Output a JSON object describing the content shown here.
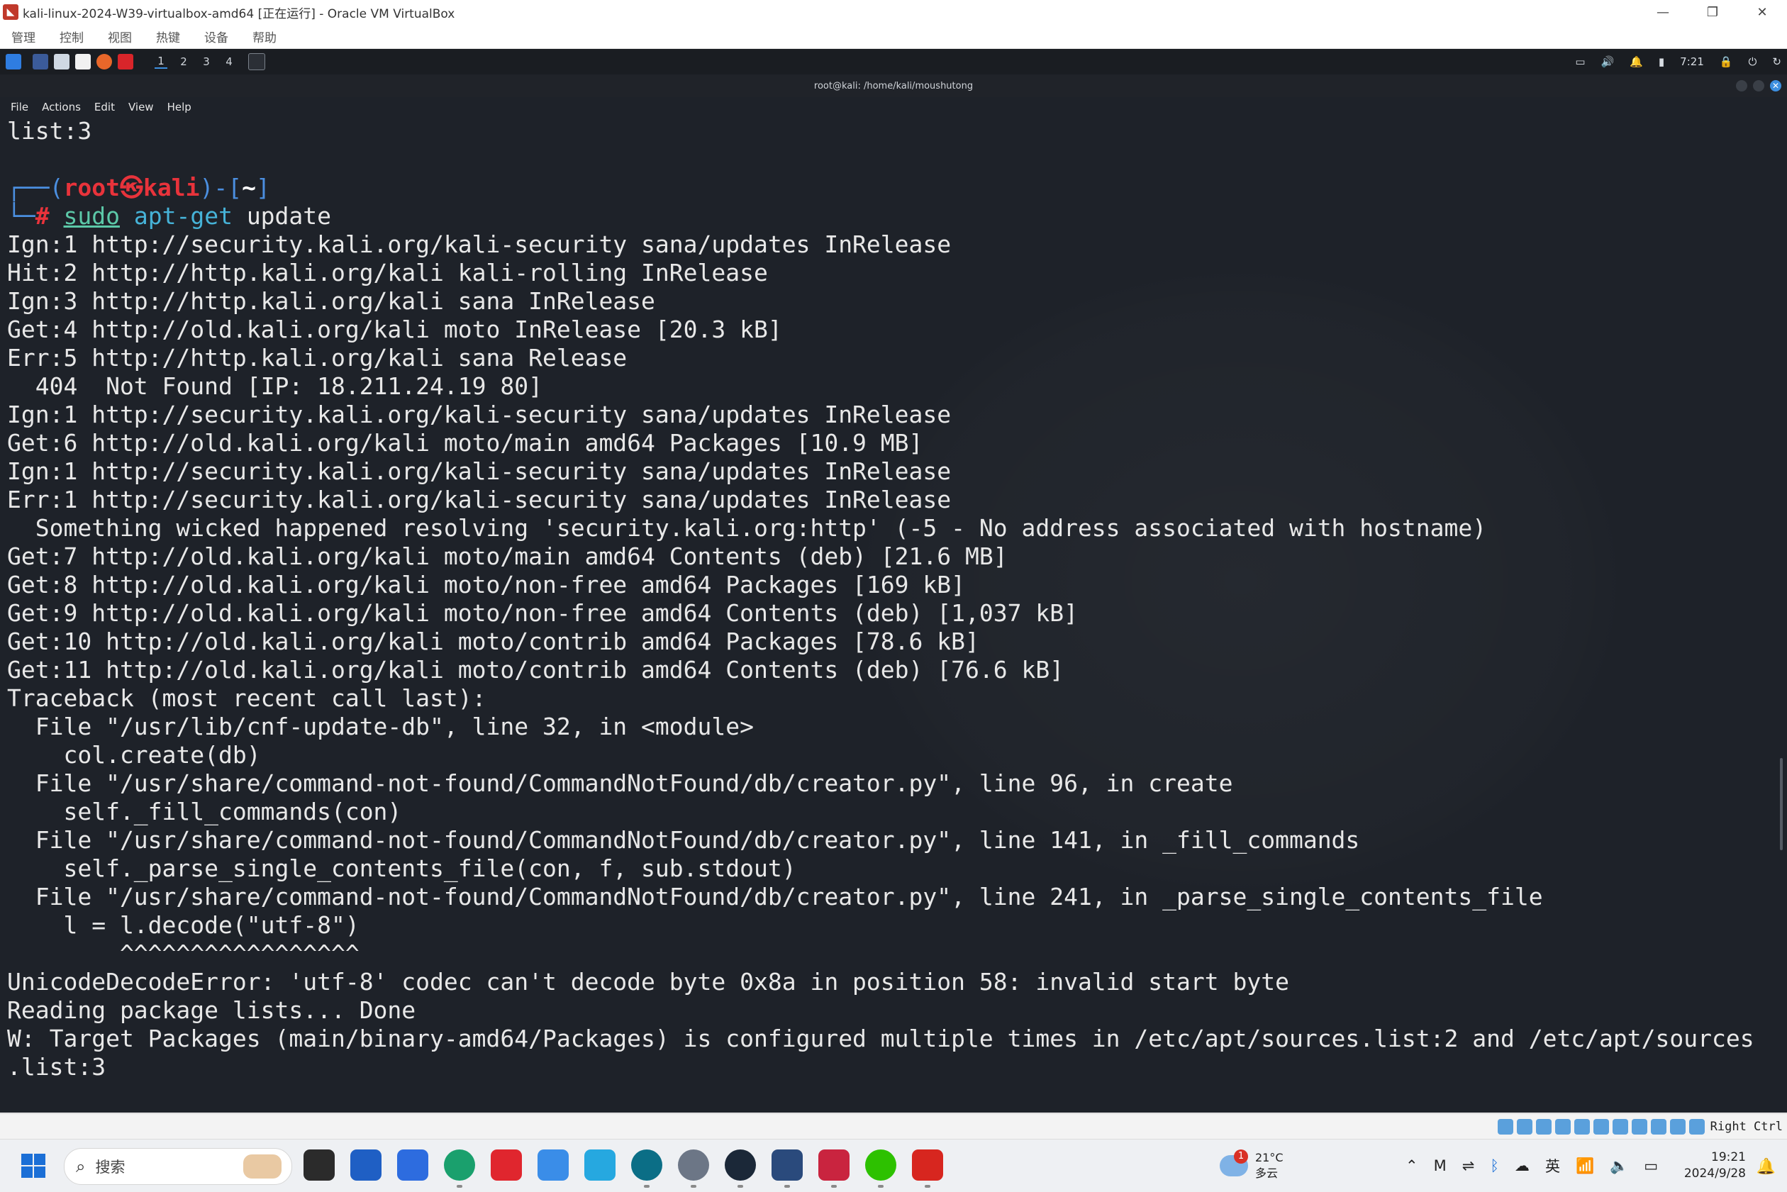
{
  "window": {
    "title": "kali-linux-2024-W39-virtualbox-amd64 [正在运行] - Oracle VM VirtualBox",
    "controls": {
      "minimize": "—",
      "restore": "❐",
      "close": "✕"
    }
  },
  "vbox_menu": [
    "管理",
    "控制",
    "视图",
    "热键",
    "设备",
    "帮助"
  ],
  "guest_panel": {
    "workspaces": [
      "1",
      "2",
      "3",
      "4"
    ],
    "time": "7:21",
    "icons": [
      "kali-menu-icon",
      "desktop-icon",
      "files-icon",
      "text-editor-icon",
      "firefox-icon",
      "terminal-icon"
    ]
  },
  "terminal": {
    "title": "root@kali: /home/kali/moushutong",
    "menu": [
      "File",
      "Actions",
      "Edit",
      "View",
      "Help"
    ],
    "top_line": "list:3",
    "prompt": {
      "bracket_open": "┌──(",
      "user": "root",
      "at": "㉿",
      "host": "kali",
      "bracket_mid": ")-[",
      "dir": "~",
      "bracket_close": "]",
      "corner": "└─",
      "hash": "#",
      "cmd1": "sudo",
      "cmd2": "apt-get",
      "cmd3": "update"
    },
    "output": [
      "Ign:1 http://security.kali.org/kali-security sana/updates InRelease",
      "Hit:2 http://http.kali.org/kali kali-rolling InRelease",
      "Ign:3 http://http.kali.org/kali sana InRelease",
      "Get:4 http://old.kali.org/kali moto InRelease [20.3 kB]",
      "Err:5 http://http.kali.org/kali sana Release",
      "  404  Not Found [IP: 18.211.24.19 80]",
      "Ign:1 http://security.kali.org/kali-security sana/updates InRelease",
      "Get:6 http://old.kali.org/kali moto/main amd64 Packages [10.9 MB]",
      "Ign:1 http://security.kali.org/kali-security sana/updates InRelease",
      "Err:1 http://security.kali.org/kali-security sana/updates InRelease",
      "  Something wicked happened resolving 'security.kali.org:http' (-5 - No address associated with hostname)",
      "Get:7 http://old.kali.org/kali moto/main amd64 Contents (deb) [21.6 MB]",
      "Get:8 http://old.kali.org/kali moto/non-free amd64 Packages [169 kB]",
      "Get:9 http://old.kali.org/kali moto/non-free amd64 Contents (deb) [1,037 kB]",
      "Get:10 http://old.kali.org/kali moto/contrib amd64 Packages [78.6 kB]",
      "Get:11 http://old.kali.org/kali moto/contrib amd64 Contents (deb) [76.6 kB]",
      "Traceback (most recent call last):",
      "  File \"/usr/lib/cnf-update-db\", line 32, in <module>",
      "    col.create(db)",
      "  File \"/usr/share/command-not-found/CommandNotFound/db/creator.py\", line 96, in create",
      "    self._fill_commands(con)",
      "  File \"/usr/share/command-not-found/CommandNotFound/db/creator.py\", line 141, in _fill_commands",
      "    self._parse_single_contents_file(con, f, sub.stdout)",
      "  File \"/usr/share/command-not-found/CommandNotFound/db/creator.py\", line 241, in _parse_single_contents_file",
      "    l = l.decode(\"utf-8\")",
      "        ^^^^^^^^^^^^^^^^^",
      "UnicodeDecodeError: 'utf-8' codec can't decode byte 0x8a in position 58: invalid start byte",
      "Reading package lists... Done",
      "W: Target Packages (main/binary-amd64/Packages) is configured multiple times in /etc/apt/sources.list:2 and /etc/apt/sources",
      ".list:3"
    ]
  },
  "vbox_status": {
    "host_key": "Right Ctrl"
  },
  "taskbar": {
    "search_placeholder": "搜索",
    "apps": [
      "file-explorer-icon",
      "microsoft-store-icon",
      "mail-icon",
      "edge-icon",
      "huawei-icon",
      "cloud-icon",
      "bilibili-icon",
      "app-icon",
      "settings-icon",
      "steam-icon",
      "virtualbox-icon",
      "kali-vm-icon",
      "wechat-icon",
      "wps-icon"
    ],
    "weather": {
      "temp": "21°C",
      "desc": "多云",
      "badge": "1"
    },
    "tray": {
      "ime": "英"
    },
    "clock": {
      "time": "19:21",
      "date": "2024/9/28"
    }
  }
}
